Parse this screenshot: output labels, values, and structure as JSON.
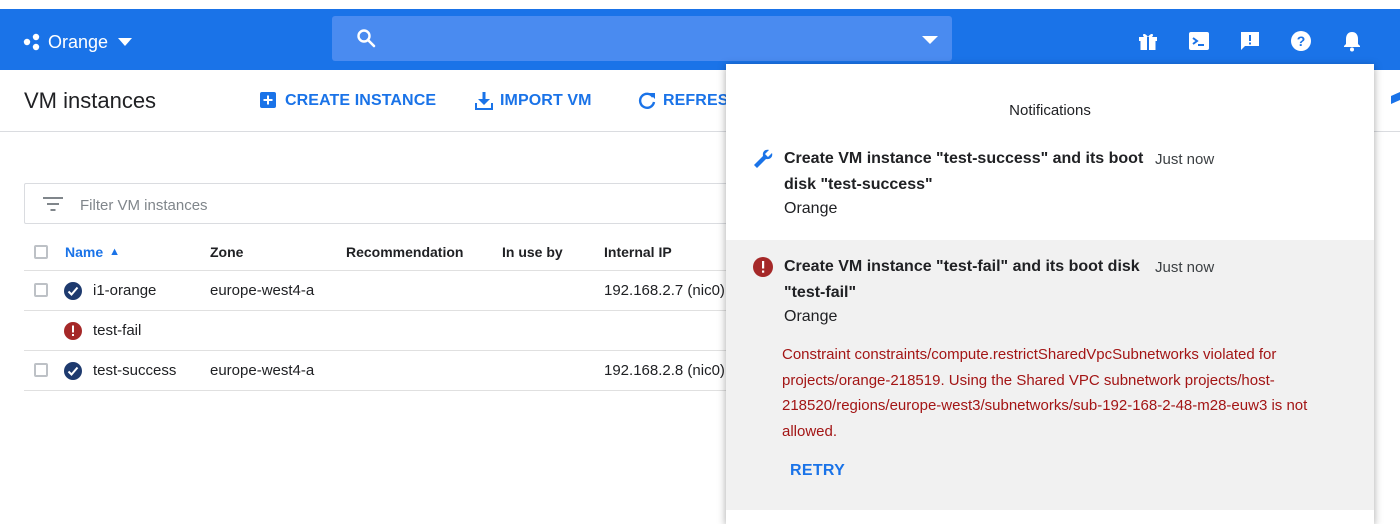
{
  "topbar": {
    "project_name": "Orange",
    "search_value": "",
    "icons": [
      "gift-icon",
      "cloud-shell-icon",
      "feedback-icon",
      "help-icon",
      "notifications-bell-icon"
    ]
  },
  "page": {
    "title": "VM instances",
    "actions": {
      "create": "CREATE INSTANCE",
      "import": "IMPORT VM",
      "refresh": "REFRESH"
    }
  },
  "filter": {
    "placeholder": "Filter VM instances"
  },
  "table": {
    "headers": {
      "name": "Name",
      "zone": "Zone",
      "recommendation": "Recommendation",
      "in_use_by": "In use by",
      "internal_ip": "Internal IP"
    },
    "rows": [
      {
        "status": "running",
        "name": "i1-orange",
        "zone": "europe-west4-a",
        "recommendation": "",
        "in_use_by": "",
        "internal_ip": "192.168.2.7 (nic0)"
      },
      {
        "status": "error",
        "name": "test-fail",
        "zone": "",
        "recommendation": "",
        "in_use_by": "",
        "internal_ip": ""
      },
      {
        "status": "running",
        "name": "test-success",
        "zone": "europe-west4-a",
        "recommendation": "",
        "in_use_by": "",
        "internal_ip": "192.168.2.8 (nic0)"
      }
    ]
  },
  "notifications": {
    "title": "Notifications",
    "items": [
      {
        "icon": "wrench-icon",
        "text": "Create VM instance \"test-success\" and its boot disk \"test-success\"",
        "time": "Just now",
        "project": "Orange"
      },
      {
        "icon": "error-icon",
        "text": "Create VM instance \"test-fail\" and its boot disk \"test-fail\"",
        "time": "Just now",
        "project": "Orange",
        "error": "Constraint constraints/compute.restrictSharedVpcSubnetworks violated for projects/orange-218519. Using the Shared VPC subnetwork projects/host-218520/regions/europe-west3/subnetworks/sub-192-168-2-48-m28-euw3 is not allowed.",
        "retry_label": "RETRY"
      }
    ]
  },
  "colors": {
    "brand_blue": "#1a73e8",
    "error_red": "#a31515",
    "status_ok": "#1e3a6e",
    "status_error": "#a52828"
  }
}
